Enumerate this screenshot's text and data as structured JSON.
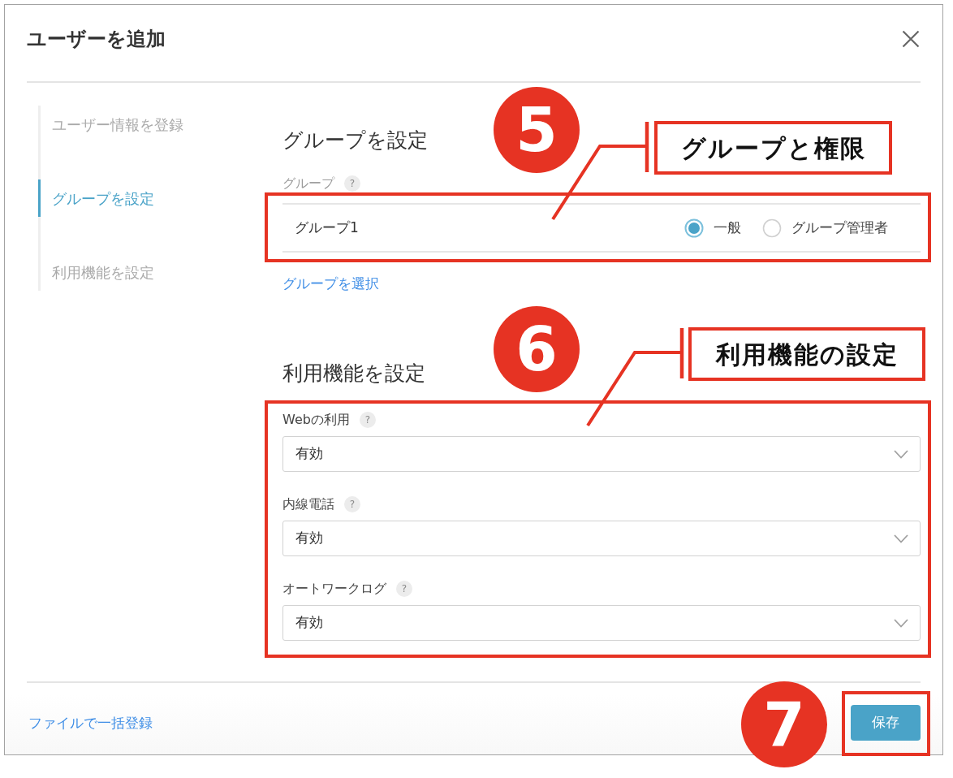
{
  "dialog": {
    "title": "ユーザーを追加"
  },
  "steps": [
    {
      "label": "ユーザー情報を登録",
      "selected": false
    },
    {
      "label": "グループを設定",
      "selected": true
    },
    {
      "label": "利用機能を設定",
      "selected": false
    }
  ],
  "group_section": {
    "heading": "グループを設定",
    "field_label": "グループ",
    "help": "?",
    "groups": [
      {
        "name": "グループ1",
        "roles": [
          {
            "label": "一般",
            "selected": true
          },
          {
            "label": "グループ管理者",
            "selected": false
          }
        ]
      }
    ],
    "select_link": "グループを選択"
  },
  "feature_section": {
    "heading": "利用機能を設定",
    "features": [
      {
        "label": "Webの利用",
        "help": "?",
        "value": "有効"
      },
      {
        "label": "内線電話",
        "help": "?",
        "value": "有効"
      },
      {
        "label": "オートワークログ",
        "help": "?",
        "value": "有効"
      }
    ]
  },
  "footer": {
    "bulk_link": "ファイルで一括登録",
    "save_button": "保存"
  },
  "annotations": [
    {
      "number": "5",
      "callout": "グループと権限"
    },
    {
      "number": "6",
      "callout": "利用機能の設定"
    },
    {
      "number": "7"
    }
  ]
}
